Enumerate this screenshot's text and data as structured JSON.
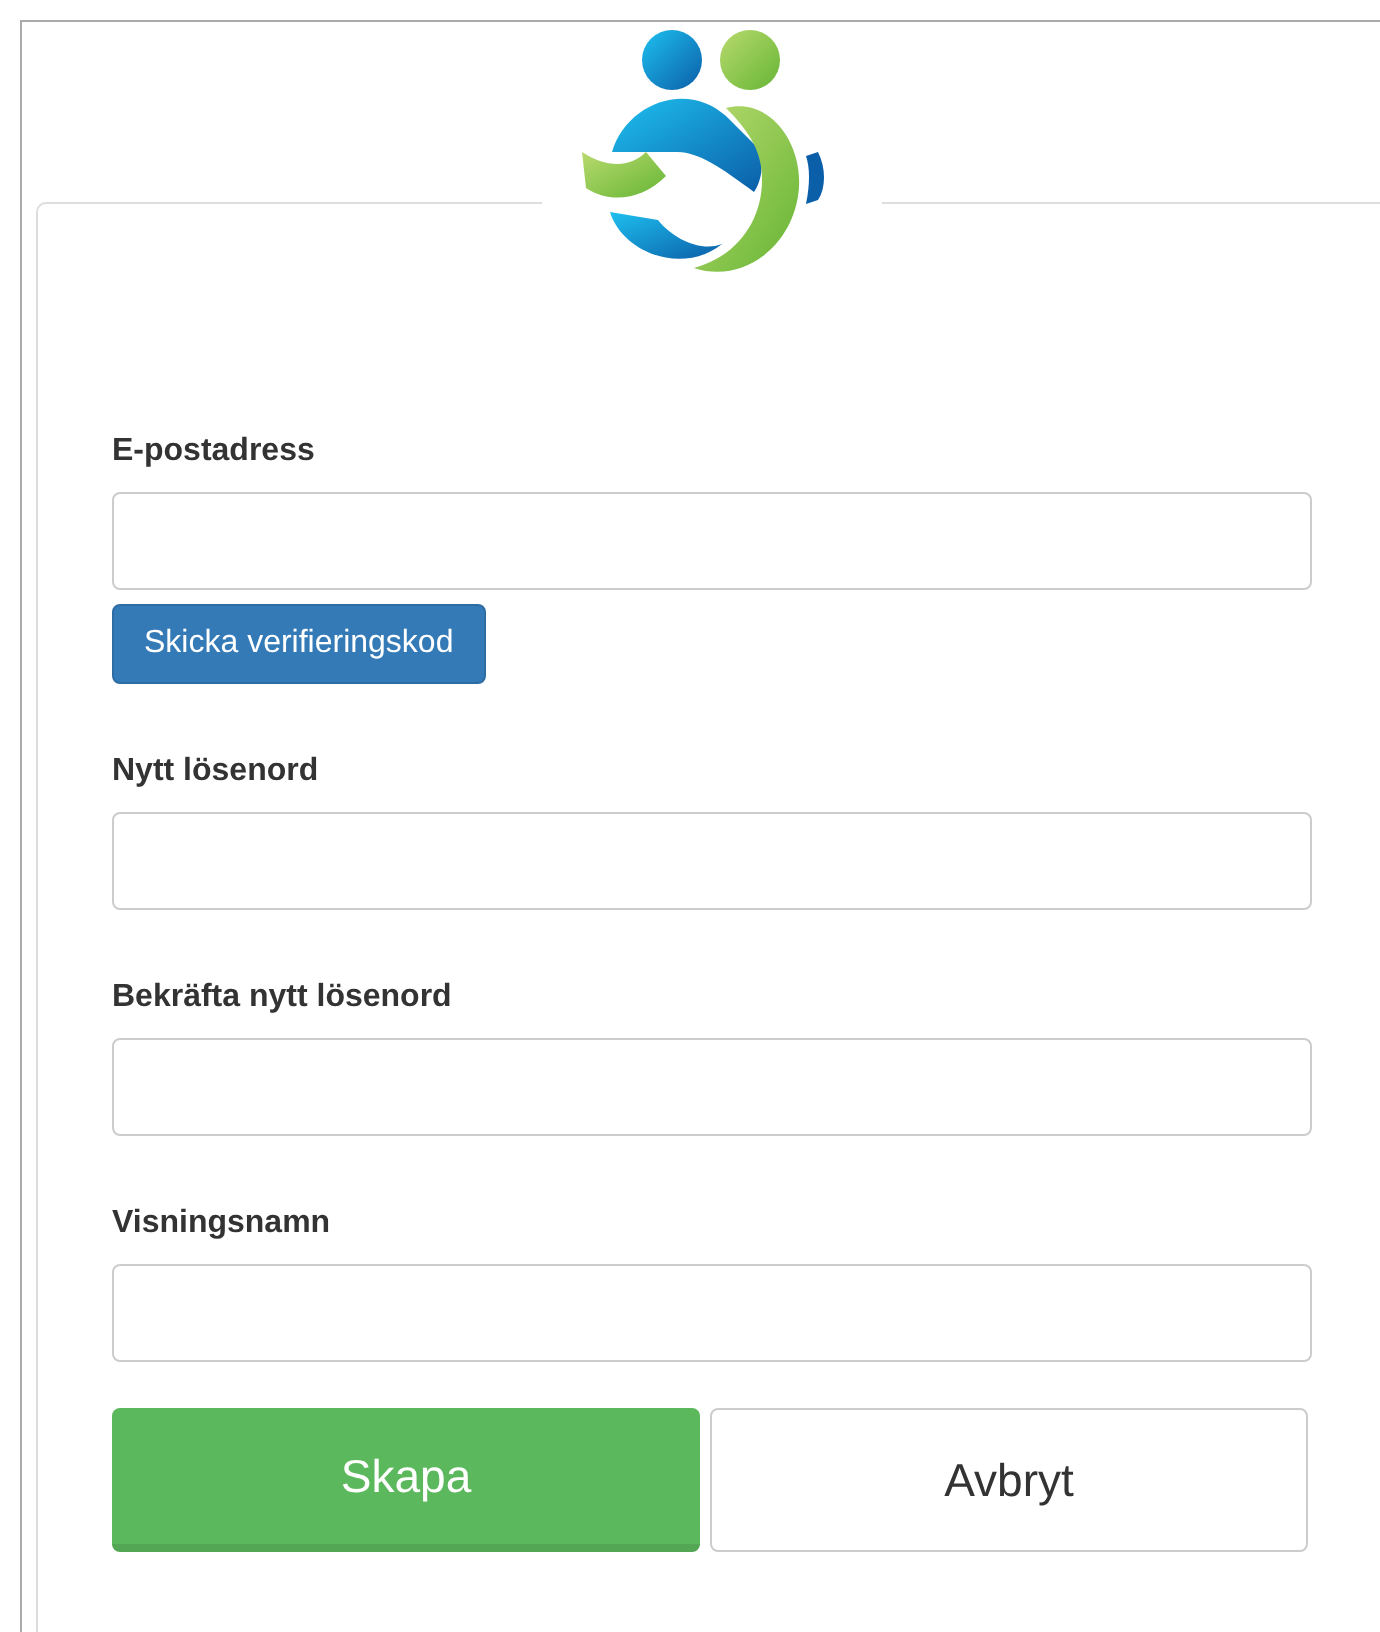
{
  "form": {
    "fields": [
      {
        "label": "E-postadress",
        "action": "Skicka verifieringskod"
      },
      {
        "label": "Nytt lösenord"
      },
      {
        "label": "Bekräfta nytt lösenord"
      },
      {
        "label": "Visningsnamn"
      }
    ],
    "buttons": [
      {
        "label": "Skapa",
        "kind": "primary"
      },
      {
        "label": "Avbryt",
        "kind": "secondary"
      }
    ]
  }
}
